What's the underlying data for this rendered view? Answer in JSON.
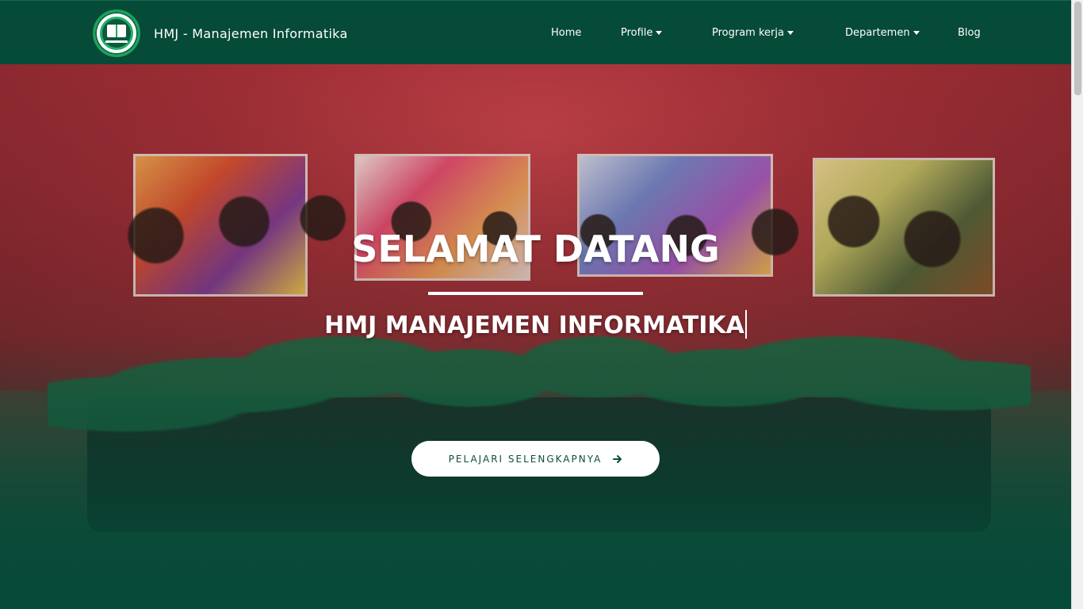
{
  "brand": {
    "name": "HMJ - Manajemen Informatika"
  },
  "nav": {
    "items": [
      {
        "label": "Home",
        "dropdown": false
      },
      {
        "label": "Profile",
        "dropdown": true
      },
      {
        "label": "Program kerja",
        "dropdown": true
      },
      {
        "label": "Departemen",
        "dropdown": true
      },
      {
        "label": "Blog",
        "dropdown": false
      }
    ]
  },
  "hero": {
    "title": "SELAMAT DATANG",
    "subtitle": "HMJ MANAJEMEN INFORMATIKA",
    "cta_label": "PELAJARI SELENGKAPNYA",
    "cta_icon": "arrow-right-icon"
  },
  "colors": {
    "navbar": "#064a38",
    "accent": "#0d4f3a",
    "white": "#ffffff"
  }
}
